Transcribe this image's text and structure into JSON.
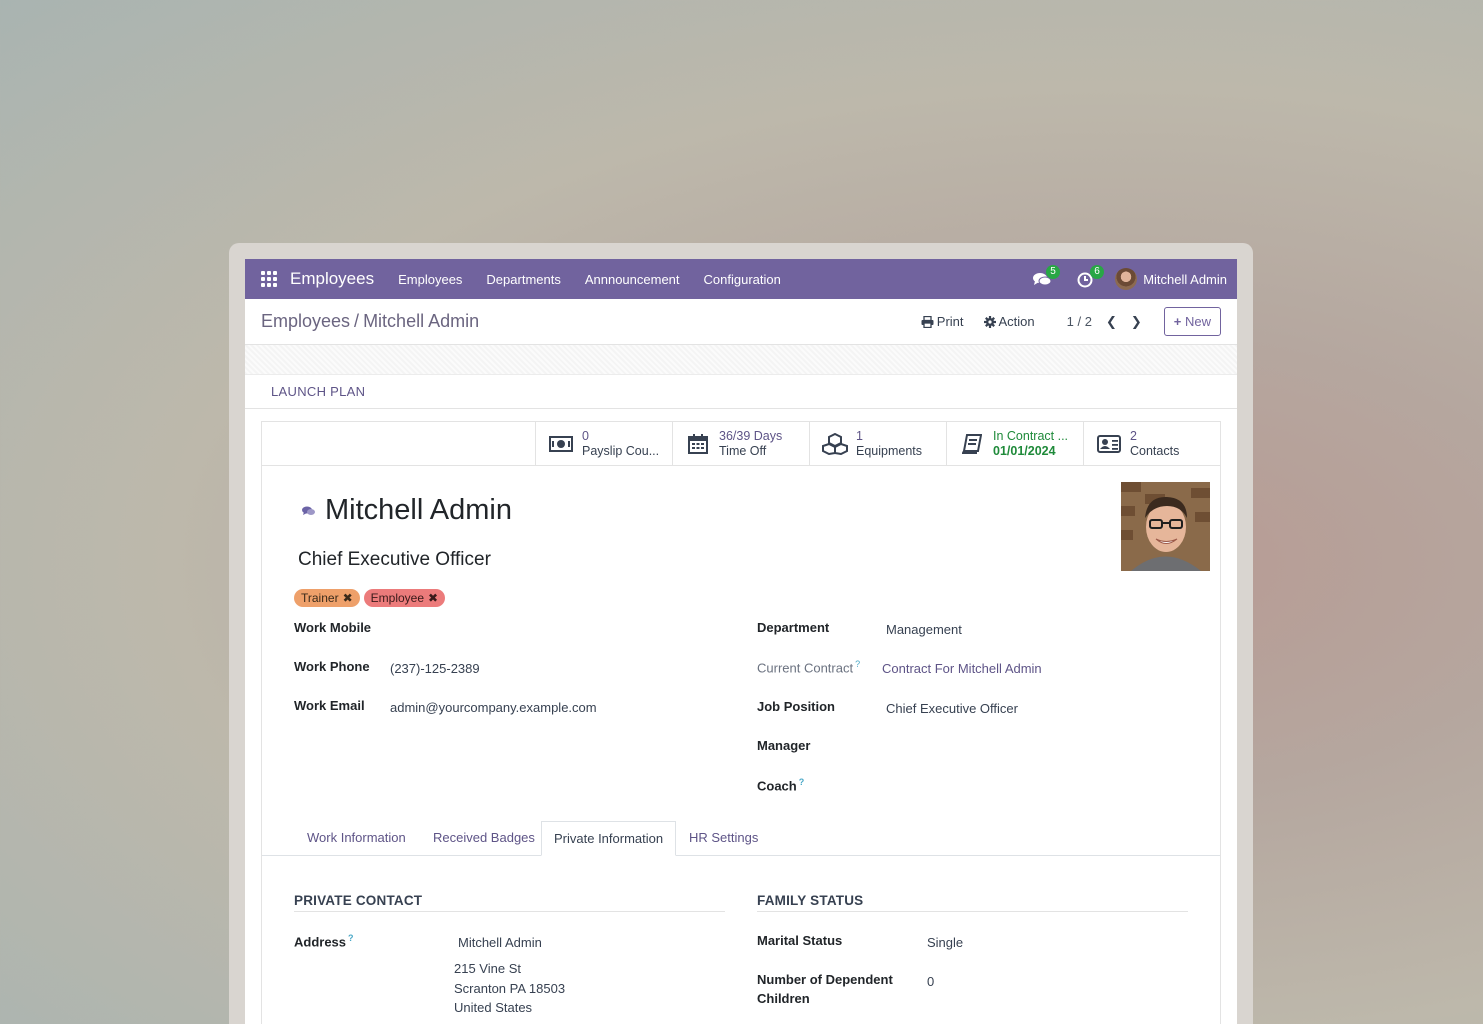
{
  "navbar": {
    "app_name": "Employees",
    "menu": [
      "Employees",
      "Departments",
      "Annnouncement",
      "Configuration"
    ],
    "messages_count": "5",
    "activities_count": "6",
    "user_name": "Mitchell Admin"
  },
  "control_panel": {
    "breadcrumb_parent": "Employees",
    "breadcrumb_separator": "/",
    "breadcrumb_current": "Mitchell Admin",
    "print_label": "Print",
    "action_label": "Action",
    "pager": "1 / 2",
    "new_label": "New"
  },
  "statusbar": {
    "launch_plan": "LAUNCH PLAN"
  },
  "stat_buttons": [
    {
      "value": "0",
      "label": "Payslip Cou...",
      "icon": "money-icon"
    },
    {
      "value": "36/39 Days",
      "label": "Time Off",
      "icon": "calendar-icon"
    },
    {
      "value": "1",
      "label": "Equipments",
      "icon": "cubes-icon"
    },
    {
      "value": "In Contract ...",
      "label": "01/01/2024",
      "icon": "book-icon"
    },
    {
      "value": "2",
      "label": "Contacts",
      "icon": "address-card-icon"
    }
  ],
  "employee": {
    "name": "Mitchell Admin",
    "job_title": "Chief Executive Officer",
    "tags": [
      "Trainer",
      "Employee"
    ]
  },
  "left_fields": {
    "work_mobile_label": "Work Mobile",
    "work_mobile_value": "",
    "work_phone_label": "Work Phone",
    "work_phone_value": "(237)-125-2389",
    "work_email_label": "Work Email",
    "work_email_value": "admin@yourcompany.example.com"
  },
  "right_fields": {
    "department_label": "Department",
    "department_value": "Management",
    "contract_label": "Current Contract",
    "contract_value": "Contract For Mitchell Admin",
    "job_position_label": "Job Position",
    "job_position_value": "Chief Executive Officer",
    "manager_label": "Manager",
    "coach_label": "Coach",
    "help_mark": "?"
  },
  "tabs": [
    "Work Information",
    "Received Badges",
    "Private Information",
    "HR Settings"
  ],
  "active_tab": "Private Information",
  "private_contact": {
    "title": "PRIVATE CONTACT",
    "address_label": "Address",
    "address_name": "Mitchell Admin",
    "address_line1": "215 Vine St",
    "address_line2": "Scranton PA 18503",
    "address_line3": "United States"
  },
  "family_status": {
    "title": "FAMILY STATUS",
    "marital_label": "Marital Status",
    "marital_value": "Single",
    "dependents_label_1": "Number of Dependent",
    "dependents_label_2": "Children",
    "dependents_value": "0"
  },
  "colors": {
    "navbar": "#71639e",
    "link": "#5e5487",
    "success": "#1f8a3a",
    "tag_trainer": "#eea06a",
    "tag_employee": "#ec7b7b"
  }
}
